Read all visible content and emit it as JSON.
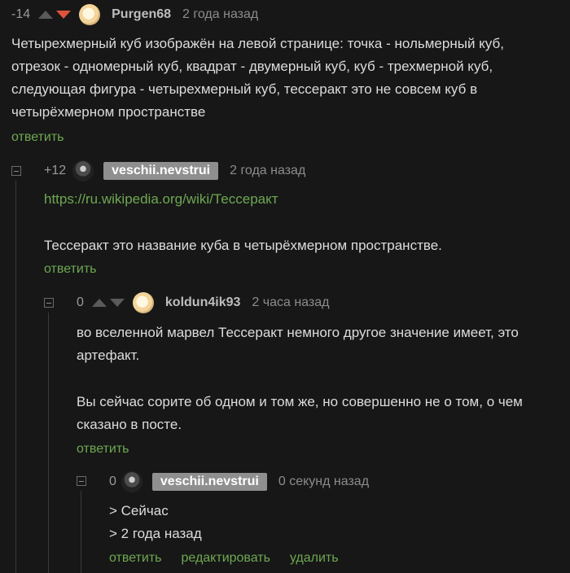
{
  "comments": [
    {
      "rating": "-14",
      "author": "Purgen68",
      "time": "2 года назад",
      "body_lines": [
        "Четырехмерный куб изображён на левой странице: точка - нольмерный куб,",
        "отрезок - одномерный куб, квадрат - двумерный куб, куб - трехмерной куб,",
        "следующая фигура - четырехмерный куб, тессеракт это не совсем куб в",
        "четырёхмерном пространстве"
      ],
      "actions": [
        "ответить"
      ]
    },
    {
      "rating": "+12",
      "author": "veschii.nevstrui",
      "time": "2 года назад",
      "link": "https://ru.wikipedia.org/wiki/Тессеракт",
      "body_lines": [
        "Тессеракт это название куба в четырёхмерном пространстве."
      ],
      "actions": [
        "ответить"
      ]
    },
    {
      "rating": "0",
      "author": "koldun4ik93",
      "time": "2 часа назад",
      "body_lines": [
        "во вселенной марвел Тессеракт немного другое значение имеет, это",
        "артефакт.",
        "Вы сейчас сорите об одном и том же, но совершенно не о том, о чем",
        "сказано в посте."
      ],
      "actions": [
        "ответить"
      ]
    },
    {
      "rating": "0",
      "author": "veschii.nevstrui",
      "time": "0 секунд назад",
      "body_lines": [
        "> Сейчас",
        "> 2 года назад"
      ],
      "actions": [
        "ответить",
        "редактировать",
        "удалить"
      ]
    }
  ]
}
